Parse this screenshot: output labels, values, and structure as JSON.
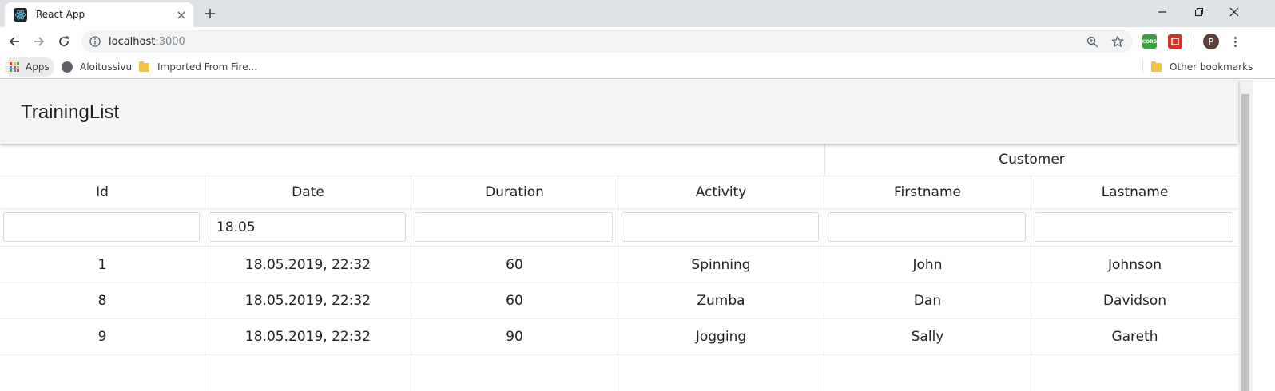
{
  "browser": {
    "tab_title": "React App",
    "url_host": "localhost",
    "url_port": ":3000",
    "profile_initial": "P",
    "extensions": [
      {
        "name": "cors-extension",
        "label": "CORS",
        "color": "#3c9e3c"
      },
      {
        "name": "red-extension",
        "label": "",
        "color": "#d93025"
      }
    ],
    "bookmarks": {
      "apps": "Apps",
      "item1": "Aloitussivu",
      "item2": "Imported From Fire...",
      "other": "Other bookmarks"
    }
  },
  "app": {
    "title": "TrainingList"
  },
  "table": {
    "group_header": "Customer",
    "columns": [
      "Id",
      "Date",
      "Duration",
      "Activity",
      "Firstname",
      "Lastname"
    ],
    "filters": [
      "",
      "18.05",
      "",
      "",
      "",
      ""
    ],
    "rows": [
      [
        "1",
        "18.05.2019, 22:32",
        "60",
        "Spinning",
        "John",
        "Johnson"
      ],
      [
        "8",
        "18.05.2019, 22:32",
        "60",
        "Zumba",
        "Dan",
        "Davidson"
      ],
      [
        "9",
        "18.05.2019, 22:32",
        "90",
        "Jogging",
        "Sally",
        "Gareth"
      ]
    ]
  },
  "colors": {
    "appbar": "#f5f5f5",
    "react_logo": "#61dafb"
  }
}
